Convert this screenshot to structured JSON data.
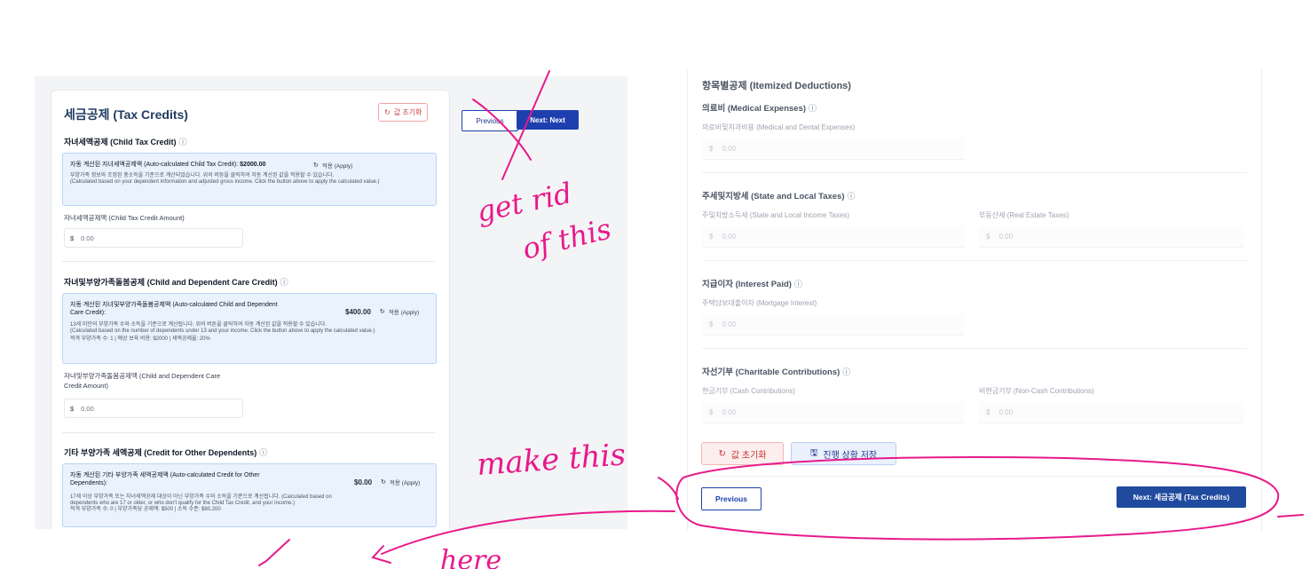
{
  "left": {
    "title": "세금공제 (Tax Credits)",
    "reset_label": "값 초기화",
    "nav": {
      "previous": "Previous",
      "next": "Next: Next"
    },
    "child_tax_credit": {
      "title": "자녀세액공제 (Child Tax Credit)",
      "calc_label": "자동 계산된 자녀세액공제액 (Auto-calculated Child Tax Credit):",
      "calc_value": "$2000.00",
      "apply": "적용 (Apply)",
      "desc_ko": "부양가족 정보와 조정된 총소득을 기준으로 계산되었습니다. 위의 버튼을 클릭하여 자동 계산된 값을 적용할 수 있습니다.",
      "desc_en": "(Calculated based on your dependent information and adjusted gross income. Click the button above to apply the calculated value.)",
      "field_label": "자녀세액공제액 (Child Tax Credit Amount)",
      "field_value": "0.00"
    },
    "dependent_care": {
      "title": "자녀및부양가족돌봄공제 (Child and Dependent Care Credit)",
      "calc_label_1": "자동 계산된 자녀및부양가족돌봄공제액 (Auto-calculated Child and Dependent",
      "calc_label_2": "Care Credit):",
      "calc_value": "$400.00",
      "apply": "적용 (Apply)",
      "desc_ko": "13세 미만의 부양가족 수와 소득을 기준으로 계산됩니다. 위의 버튼을 클릭하여 자동 계산된 값을 적용할 수 있습니다.",
      "desc_en": "(Calculated based on the number of dependents under 13 and your income. Click the button above to apply the calculated value.)",
      "meta": "적격 부양가족 수: 1 | 예상 보육 비용: $2000 | 세액공제율: 20%",
      "field_label_1": "자녀및부양가족돌봄공제액 (Child and Dependent Care",
      "field_label_2": "Credit Amount)",
      "field_value": "0.00"
    },
    "other_dependents": {
      "title": "기타 부양가족 세액공제 (Credit for Other Dependents)",
      "calc_label_1": "자동 계산된 기타 부양가족 세액공제액 (Auto-calculated Credit for Other",
      "calc_label_2": "Dependents):",
      "calc_value": "$0.00",
      "apply": "적용 (Apply)",
      "desc_1": "17세 이상 부양가족 또는 자녀세액공제 대상이 아닌 부양가족 수와 소득을 기준으로 계산됩니다. (Calculated based on",
      "desc_2": "dependents who are 17 or older, or who don't qualify for the Child Tax Credit, and your income.)",
      "meta": "적격 부양가족 수: 0 | 부양가족당 공제액: $500 | 소득 수준: $80,200"
    },
    "currency": "$"
  },
  "right": {
    "title": "항목별공제 (Itemized Deductions)",
    "medical": {
      "title": "의료비 (Medical Expenses)",
      "label": "의료비및치과비용 (Medical and Dental Expenses)",
      "value": "0.00"
    },
    "state_local": {
      "title": "주세및지방세 (State and Local Taxes)",
      "label_a": "주및지방소득세 (State and Local Income Taxes)",
      "label_b": "부동산세 (Real Estate Taxes)",
      "value_a": "0.00",
      "value_b": "0.00"
    },
    "interest": {
      "title": "지급이자 (Interest Paid)",
      "label": "주택담보대출이자 (Mortgage Interest)",
      "value": "0.00"
    },
    "charity": {
      "title": "자선기부 (Charitable Contributions)",
      "label_a": "현금기부 (Cash Contributions)",
      "label_b": "비현금기부 (Non-Cash Contributions)",
      "value_a": "0.00",
      "value_b": "0.00"
    },
    "reset_label": "값 초기화",
    "save_label": "진행 상황 저장",
    "previous": "Previous",
    "next": "Next: 세금공제 (Tax Credits)",
    "currency": "$"
  },
  "annotations": {
    "note1_line1": "get rid",
    "note1_line2": "of this",
    "note2": "make this",
    "note3": "here",
    "color": "#e8198b"
  },
  "colors": {
    "primary": "#1e40af",
    "danger": "#d14343",
    "info_bg": "#eaf2fd"
  }
}
